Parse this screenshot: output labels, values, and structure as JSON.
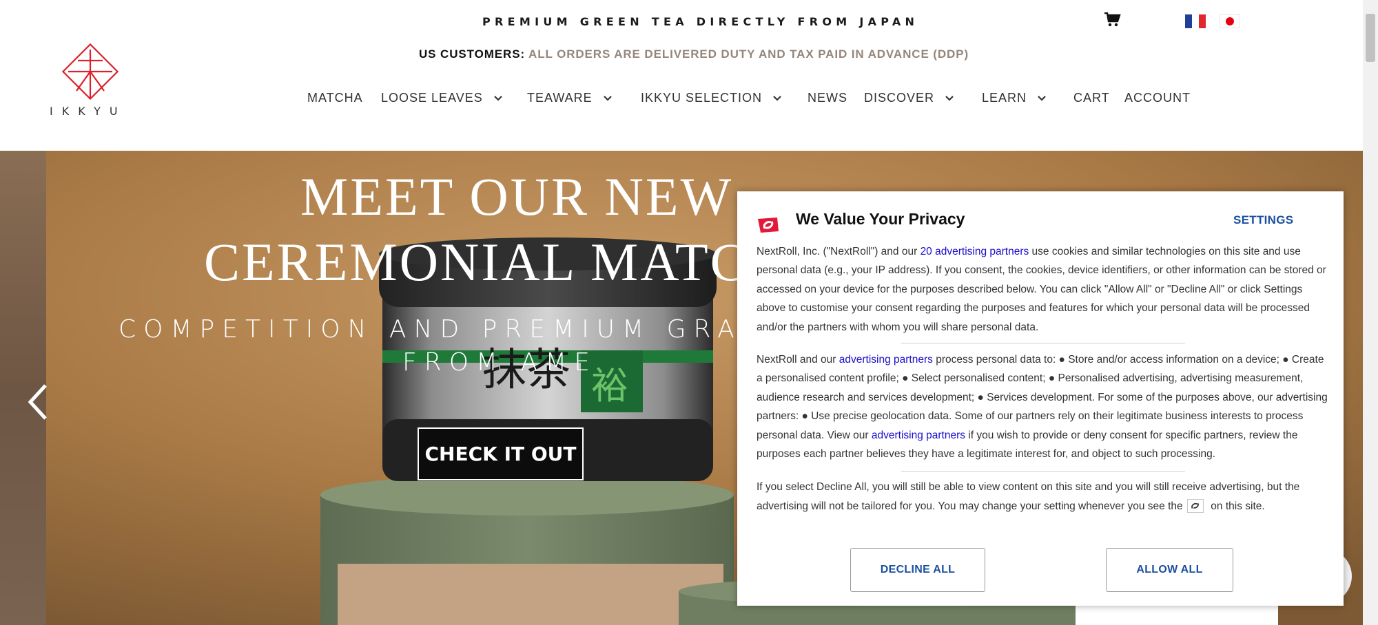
{
  "header": {
    "tagline": "PREMIUM GREEN TEA DIRECTLY FROM JAPAN",
    "us_label": "US CUSTOMERS:",
    "us_text": "ALL ORDERS ARE DELIVERED DUTY AND TAX PAID IN ADVANCE (DDP)",
    "logo_text": "IKKYU",
    "cart_icon": "shopping-cart-icon",
    "languages": [
      "fr",
      "jp"
    ]
  },
  "nav": {
    "items": [
      {
        "label": "MATCHA",
        "dropdown": false
      },
      {
        "label": "LOOSE LEAVES",
        "dropdown": true
      },
      {
        "label": "TEAWARE",
        "dropdown": true
      },
      {
        "label": "IKKYU SELECTION",
        "dropdown": true
      },
      {
        "label": "NEWS",
        "dropdown": false
      },
      {
        "label": "DISCOVER",
        "dropdown": true
      },
      {
        "label": "LEARN",
        "dropdown": true
      },
      {
        "label": "CART",
        "dropdown": false
      },
      {
        "label": "ACCOUNT",
        "dropdown": false
      }
    ]
  },
  "hero": {
    "title_line1": "MEET OUR NEW",
    "title_line2": "CEREMONIAL MATCH",
    "subtitle_line1": "COMPETITION AND PREMIUM GRADE",
    "subtitle_line2": "FROM AME",
    "cta_label": "CHECK IT OUT"
  },
  "consent": {
    "title": "We Value Your Privacy",
    "settings_label": "SETTINGS",
    "p1_before": "NextRoll, Inc. (\"NextRoll\") and our ",
    "p1_link": "20 advertising partners",
    "p1_after": " use cookies and similar technologies on this site and use personal data (e.g., your IP address). If you consent, the cookies, device identifiers, or other information can be stored or accessed on your device for the purposes described below. You can click \"Allow All\" or \"Decline All\" or click Settings above to customise your consent regarding the purposes and features for which your personal data will be processed and/or the partners with whom you will share personal data.",
    "p2_before": "NextRoll and our ",
    "p2_link1": "advertising partners",
    "p2_middle": " process personal data to: ● Store and/or access information on a device; ● Create a personalised content profile; ● Select personalised content; ● Personalised advertising, advertising measurement, audience research and services development; ● Services development. For some of the purposes above, our advertising partners: ● Use precise geolocation data. Some of our partners rely on their legitimate business interests to process personal data. View our ",
    "p2_link2": "advertising partners",
    "p2_after": " if you wish to provide or deny consent for specific partners, review the purposes each partner believes they have a legitimate interest for, and object to such processing.",
    "p3_before": "If you select Decline All, you will still be able to view content on this site and you will still receive advertising, but the advertising will not be tailored for you. You may change your setting whenever you see the ",
    "p3_after": " on this site.",
    "decline_label": "DECLINE ALL",
    "allow_label": "ALLOW ALL"
  },
  "colors": {
    "brand_red": "#d9222a",
    "link_blue": "#1a0dcc",
    "button_blue": "#1a4fa0",
    "notice_taupe": "#94857a"
  }
}
